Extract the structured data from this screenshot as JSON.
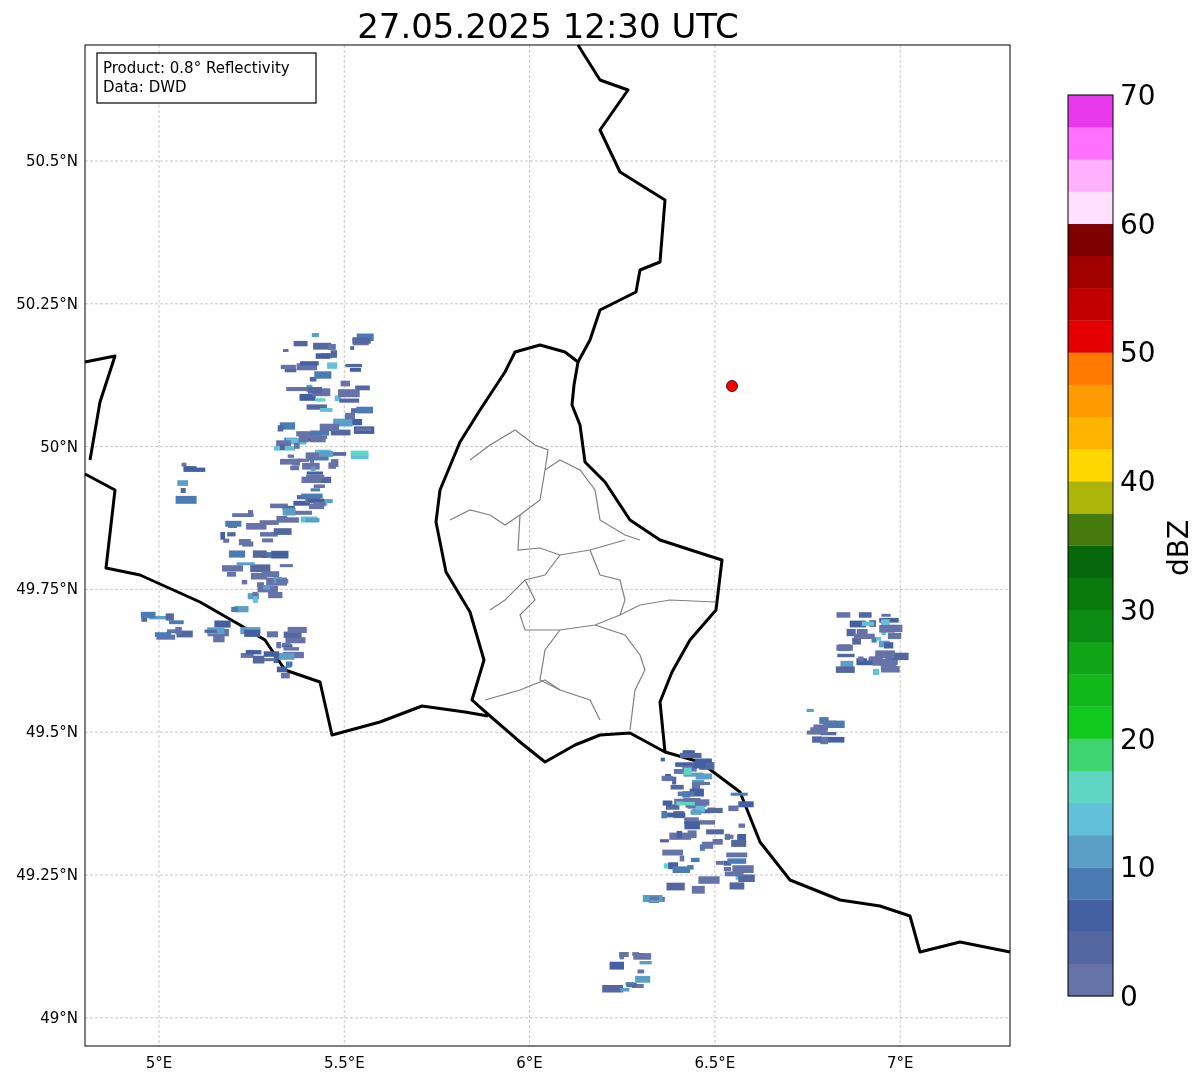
{
  "title": "27.05.2025 12:30 UTC",
  "info_box": {
    "lines": [
      "Product: 0.8° Reflectivity",
      "Data: DWD"
    ]
  },
  "axes": {
    "yticks": [
      "50.5°N",
      "50.25°N",
      "50°N",
      "49.75°N",
      "49.5°N",
      "49.25°N",
      "49°N"
    ],
    "xticks": [
      "5°E",
      "5.5°E",
      "6°E",
      "6.5°E",
      "7°E"
    ]
  },
  "colorbar": {
    "label": "dBZ",
    "ticks": [
      "70",
      "60",
      "50",
      "40",
      "30",
      "20",
      "10",
      "0"
    ],
    "segments": [
      {
        "color": "#6673a8"
      },
      {
        "color": "#5467a0"
      },
      {
        "color": "#4460a3"
      },
      {
        "color": "#4a7bb3"
      },
      {
        "color": "#5b9ec6"
      },
      {
        "color": "#62c0da"
      },
      {
        "color": "#5fd6c3"
      },
      {
        "color": "#3ed470"
      },
      {
        "color": "#12c91d"
      },
      {
        "color": "#11b81a"
      },
      {
        "color": "#10a516"
      },
      {
        "color": "#0c8c12"
      },
      {
        "color": "#0a7a0f"
      },
      {
        "color": "#06680b"
      },
      {
        "color": "#467a0d"
      },
      {
        "color": "#adb40a"
      },
      {
        "color": "#ffd700"
      },
      {
        "color": "#ffb500"
      },
      {
        "color": "#ff9a00"
      },
      {
        "color": "#ff7a00"
      },
      {
        "color": "#e40000"
      },
      {
        "color": "#c20000"
      },
      {
        "color": "#a00000"
      },
      {
        "color": "#7f0000"
      },
      {
        "color": "#ffe0ff"
      },
      {
        "color": "#ffb0ff"
      },
      {
        "color": "#ff70ff"
      },
      {
        "color": "#e838ec"
      }
    ]
  }
}
